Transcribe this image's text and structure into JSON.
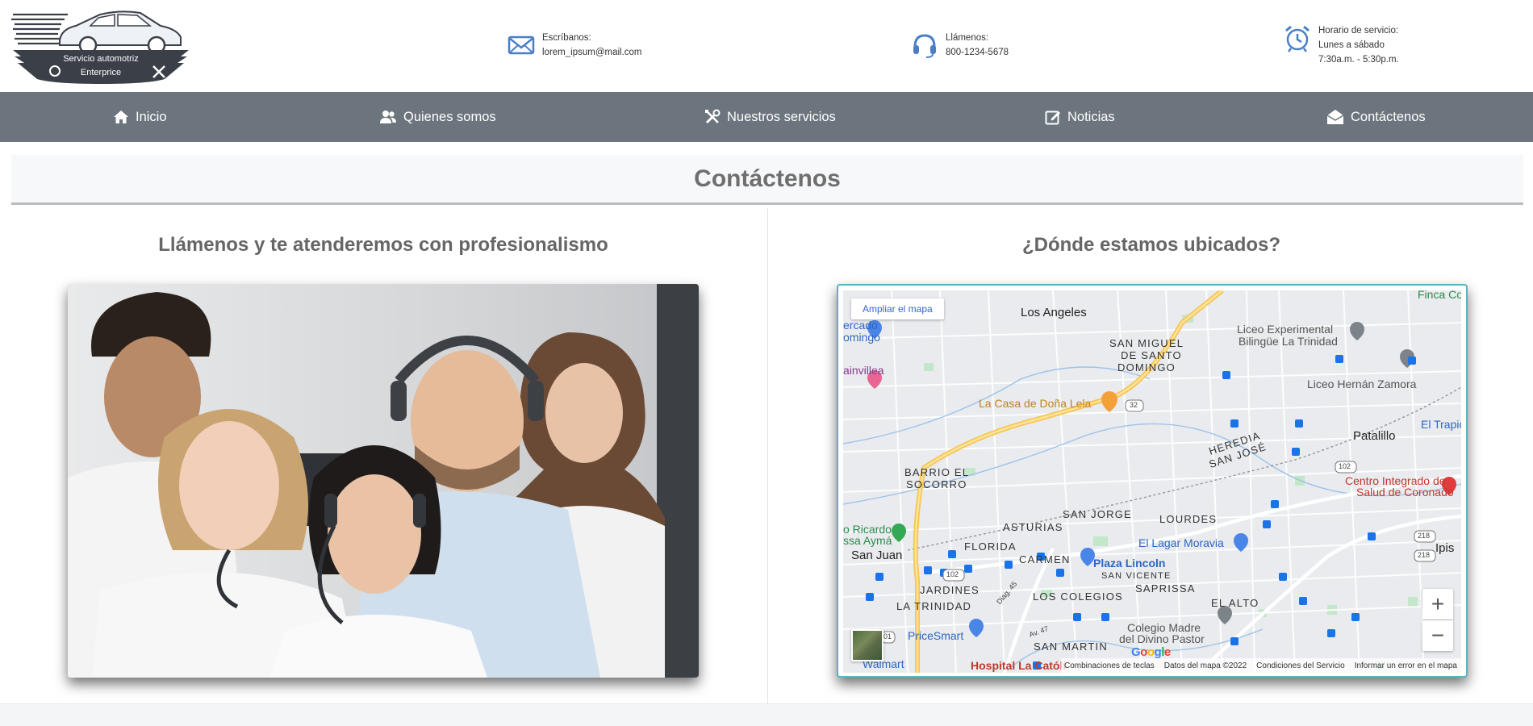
{
  "header": {
    "logo": {
      "line1": "Servicio automotriz",
      "line2": "Enterprice"
    },
    "email": {
      "label": "Escríbanos:",
      "value": "lorem_ipsum@mail.com",
      "icon": "envelope-icon"
    },
    "phone": {
      "label": "Llámenos:",
      "value": "800-1234-5678",
      "icon": "headset-icon"
    },
    "hours": {
      "label": "Horario de servicio:",
      "days": "Lunes a sábado",
      "time": "7:30a.m. - 5:30p.m.",
      "icon": "alarm-clock-icon"
    }
  },
  "nav": {
    "items": [
      {
        "label": "Inicio",
        "icon": "home-icon"
      },
      {
        "label": "Quienes somos",
        "icon": "users-icon"
      },
      {
        "label": "Nuestros servicios",
        "icon": "tools-icon"
      },
      {
        "label": "Noticias",
        "icon": "edit-icon"
      },
      {
        "label": "Contáctenos",
        "icon": "envelope-open-icon"
      }
    ]
  },
  "page": {
    "title": "Contáctenos",
    "left_heading": "Llámenos y te atenderemos con profesionalismo",
    "right_heading": "¿Dónde estamos ubicados?"
  },
  "map": {
    "expand_label": "Ampliar el mapa",
    "zoom_in": "+",
    "zoom_out": "−",
    "google": "Google",
    "attribution": [
      "Combinaciones de teclas",
      "Datos del mapa ©2022",
      "Condiciones del Servicio",
      "Informar un error en el mapa"
    ],
    "labels": {
      "los_angeles": "Los Angeles",
      "san_miguel_1": "SAN MIGUEL",
      "san_miguel_2": "DE SANTO",
      "san_miguel_3": "DOMINGO",
      "mercado_1": "ercado",
      "mercado_2": "omingo",
      "buganvillea": "ainvillea",
      "dona_lela": "La Casa de Doña Lela",
      "liceo_exp_1": "Liceo Experimental",
      "liceo_exp_2": "Bilingüe La Trinidad",
      "liceo_hz": "Liceo Hernán Zamora",
      "finca": "Finca Co",
      "trapiche": "El Trapic",
      "patalillo": "Patalillo",
      "heredia": "HEREDIA",
      "san_jose": "SAN JOSÉ",
      "centro_1": "Centro Integrado de",
      "centro_2": "Salud de Coronado",
      "barrio_1": "BARRIO EL",
      "barrio_2": "SOCORRO",
      "san_jorge": "SAN JORGE",
      "lourdes": "LOURDES",
      "asturias": "ASTURIAS",
      "florida": "FLORIDA",
      "carmen": "CARMEN",
      "lagar": "El Lagar Moravia",
      "plaza_lincoln": "Plaza Lincoln",
      "san_vicente": "SAN VICENTE",
      "ipis": "Ipis",
      "ricardo_1": "o Ricardo",
      "ricardo_2": "ssa Aymá",
      "san_juan": "San Juan",
      "jardines": "JARDINES",
      "la_trinidad": "LA TRINIDAD",
      "los_colegios": "LOS COLEGIOS",
      "saprissa": "SAPRISSA",
      "el_alto": "EL ALTO",
      "colegio_1": "Colegio Madre",
      "colegio_2": "del Divino Pastor",
      "pricesmart": "PriceSmart",
      "san_martin": "SAN MARTIN",
      "walmart": "Walmart",
      "hospital": "Hospital La Católi",
      "r32": "32",
      "r102": "102",
      "r102b": "102",
      "r218": "218",
      "r218b": "218",
      "r101": "01",
      "diag45": "Diag. 45",
      "av47": "Av. 47"
    }
  },
  "colors": {
    "nav_bg": "#6c757d",
    "icon_blue": "#4a7fc8",
    "map_border": "#5ab3c0"
  }
}
